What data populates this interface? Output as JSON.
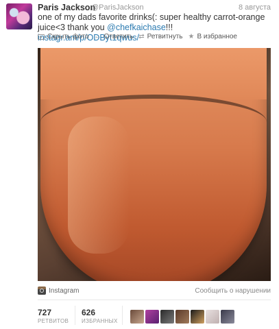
{
  "tweet": {
    "author_name": "Paris Jackson",
    "author_handle": "@ParisJackson",
    "date": "8 августа",
    "text_part1": "one of my dads favorite drinks(: super healthy carrot-orange juice<3 thank you ",
    "mention": "@chefkaichase",
    "text_part2": "!!! ",
    "link": "instagr.am/p/ODByt1qwus/"
  },
  "actions": {
    "hide_photo": "Скрыть фото",
    "reply": "Ответить",
    "retweet": "Ретвитнуть",
    "favorite": "В избранное"
  },
  "media": {
    "source": "Instagram",
    "report": "Сообщить о нарушении"
  },
  "stats": {
    "retweets_count": "727",
    "retweets_label": "РЕТВИТОВ",
    "favorites_count": "626",
    "favorites_label": "ИЗБРАННЫХ"
  },
  "colors": {
    "link": "#2a7ab0",
    "muted": "#999999"
  }
}
